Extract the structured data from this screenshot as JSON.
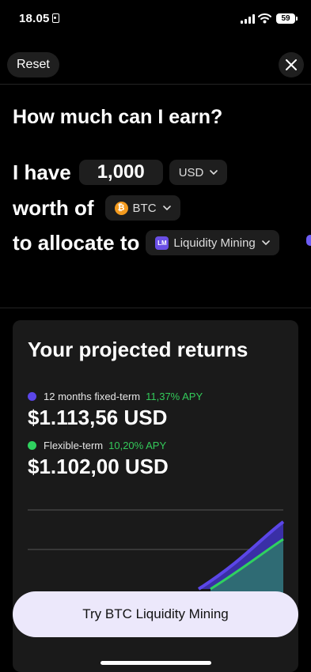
{
  "status_bar": {
    "time": "18.05",
    "battery": "59"
  },
  "nav": {
    "reset_label": "Reset"
  },
  "heading": "How much can I earn?",
  "form": {
    "i_have_label": "I have",
    "amount_value": "1,000",
    "currency": "USD",
    "worth_of_label": "worth of",
    "asset": "BTC",
    "asset_icon_glyph": "₿",
    "allocate_label": "to allocate to",
    "product": "Liquidity Mining",
    "product_badge": "LM"
  },
  "card": {
    "title": "Your projected returns",
    "fixed": {
      "term": "12 months fixed-term",
      "apy": "11,37% APY",
      "amount": "$1.113,56 USD",
      "color": "#5b46e8"
    },
    "flexible": {
      "term": "Flexible-term",
      "apy": "10,20% APY",
      "amount": "$1.102,00 USD",
      "color": "#2fd15f"
    }
  },
  "cta_label": "Try BTC Liquidity Mining",
  "colors": {
    "accent": "#6d5df5",
    "apy_green": "#33c95a",
    "cta_bg": "#ece8fb"
  },
  "icons": [
    "lock-icon",
    "signal-icon",
    "wifi-icon",
    "battery-icon",
    "close-icon",
    "chevron-down-icon",
    "btc-coin-icon",
    "liquidity-mining-icon"
  ]
}
